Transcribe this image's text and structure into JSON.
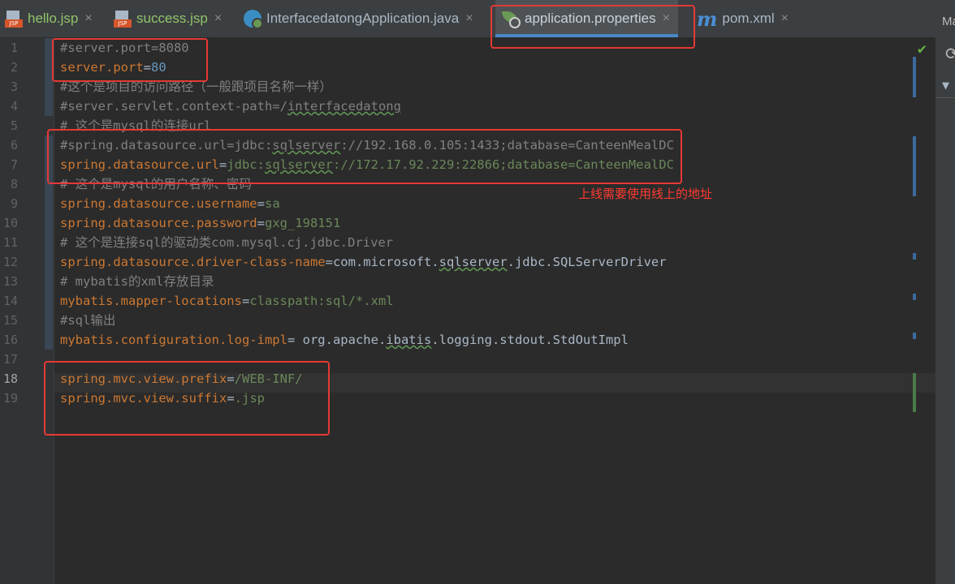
{
  "tabs": [
    {
      "label": "hello.jsp",
      "icon": "jsp-file-icon"
    },
    {
      "label": "success.jsp",
      "icon": "jsp-file-icon"
    },
    {
      "label": "InterfacedatongApplication.java",
      "icon": "spring-class-icon"
    },
    {
      "label": "application.properties",
      "icon": "spring-properties-icon",
      "active": true
    },
    {
      "label": "pom.xml",
      "icon": "maven-icon"
    }
  ],
  "tab_close_glyph": "×",
  "side_panel": {
    "label": "Ma",
    "refresh_icon": "refresh-icon",
    "collapse_icon": "triangle-down-icon"
  },
  "line_numbers": [
    "1",
    "2",
    "3",
    "4",
    "5",
    "6",
    "7",
    "8",
    "9",
    "10",
    "11",
    "12",
    "13",
    "14",
    "15",
    "16",
    "17",
    "18",
    "19"
  ],
  "code_lines": [
    {
      "n": 1,
      "text": "#server.port=8080"
    },
    {
      "n": 2,
      "key": "server.port",
      "value": "80"
    },
    {
      "n": 3,
      "text": "#这个是项目的访问路径（一般跟项目名称一样）"
    },
    {
      "n": 4,
      "text": "#server.servlet.context-path=/interfacedatong"
    },
    {
      "n": 5,
      "text": "# 这个是mysql的连接url"
    },
    {
      "n": 6,
      "text": "#spring.datasource.url=jdbc:sqlserver://192.168.0.105:1433;database=CanteenMealDC"
    },
    {
      "n": 7,
      "key": "spring.datasource.url",
      "value": "jdbc:sqlserver://172.17.92.229:22866;database=CanteenMealDC"
    },
    {
      "n": 8,
      "text": "# 这个是mysql的用户名称、密码"
    },
    {
      "n": 9,
      "key": "spring.datasource.username",
      "value": "sa"
    },
    {
      "n": 10,
      "key": "spring.datasource.password",
      "value": "gxg_198151"
    },
    {
      "n": 11,
      "text": "# 这个是连接sql的驱动类com.mysql.cj.jdbc.Driver"
    },
    {
      "n": 12,
      "key": "spring.datasource.driver-class-name",
      "value": "com.microsoft.sqlserver.jdbc.SQLServerDriver"
    },
    {
      "n": 13,
      "text": "# mybatis的xml存放目录"
    },
    {
      "n": 14,
      "key": "mybatis.mapper-locations",
      "value": "classpath:sql/*.xml"
    },
    {
      "n": 15,
      "text": "#sql输出"
    },
    {
      "n": 16,
      "key": "mybatis.configuration.log-impl",
      "value": " org.apache.ibatis.logging.stdout.StdOutImpl"
    },
    {
      "n": 17,
      "text": ""
    },
    {
      "n": 18,
      "key": "spring.mvc.view.prefix",
      "value": "/WEB-INF/"
    },
    {
      "n": 19,
      "key": "spring.mvc.view.suffix",
      "value": ".jsp"
    }
  ],
  "annotation": "上线需要使用线上的地址",
  "inspection_icon": "check-icon",
  "colors": {
    "key": "#cc7832",
    "value": "#6a8759",
    "comment": "#808080",
    "highlight": "#e53935"
  }
}
